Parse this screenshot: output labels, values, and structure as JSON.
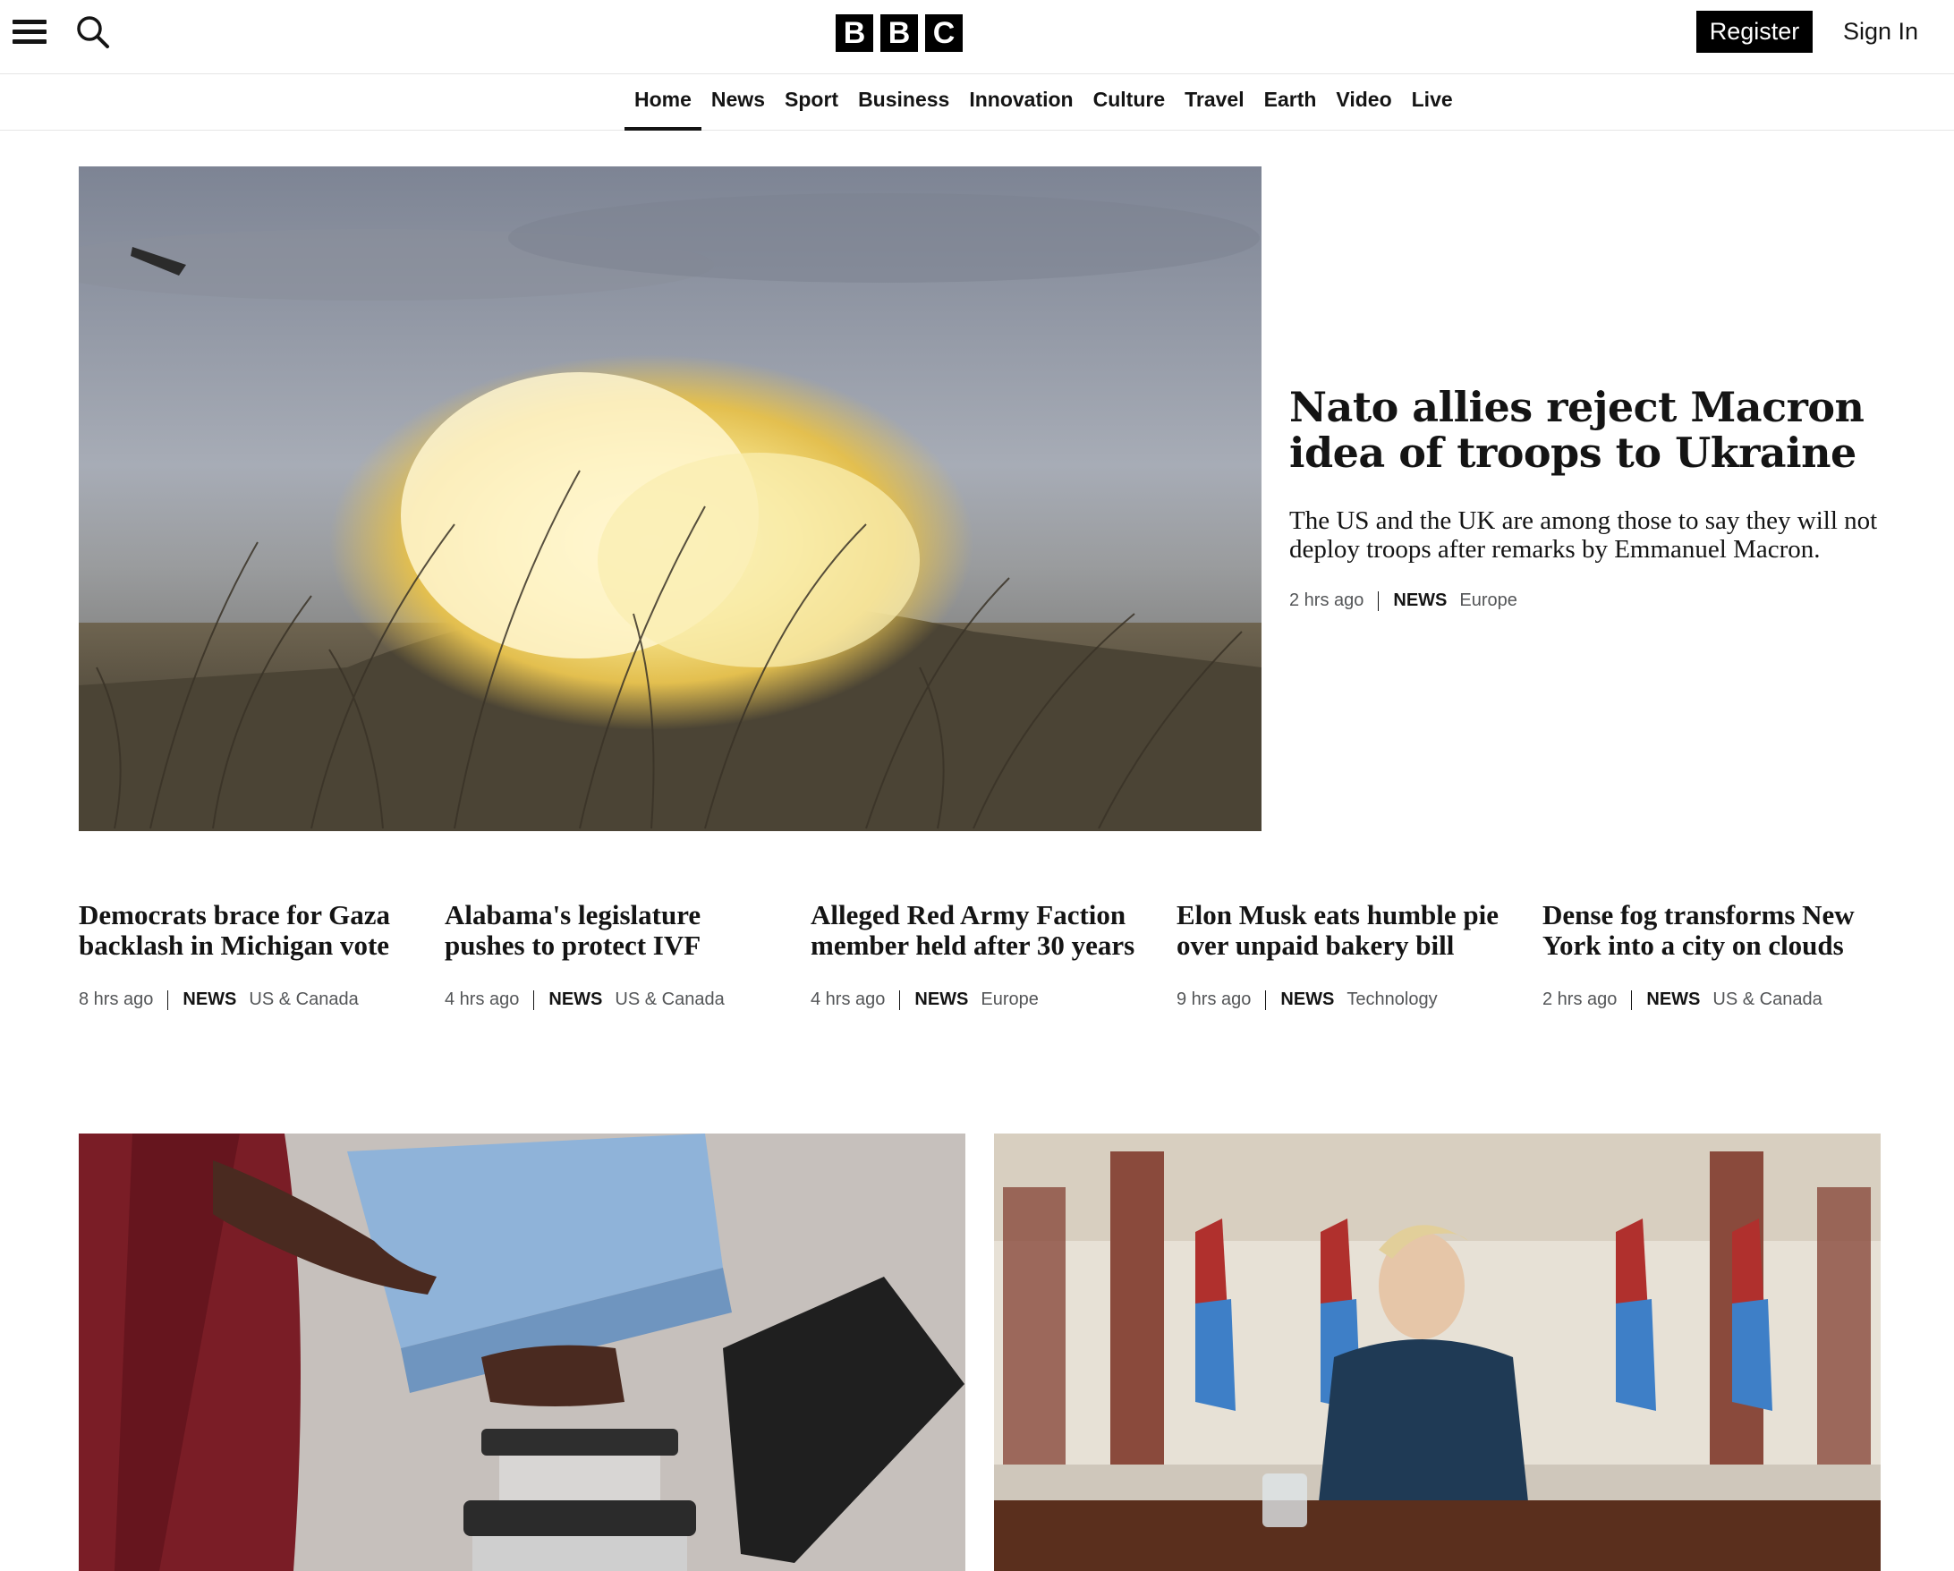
{
  "header": {
    "logo_letters": [
      "B",
      "B",
      "C"
    ],
    "register_label": "Register",
    "signin_label": "Sign In"
  },
  "nav": {
    "items": [
      {
        "label": "Home",
        "active": true
      },
      {
        "label": "News"
      },
      {
        "label": "Sport"
      },
      {
        "label": "Business"
      },
      {
        "label": "Innovation"
      },
      {
        "label": "Culture"
      },
      {
        "label": "Travel"
      },
      {
        "label": "Earth"
      },
      {
        "label": "Video"
      },
      {
        "label": "Live"
      }
    ]
  },
  "hero": {
    "title": "Nato allies reject Macron idea of troops to Ukraine",
    "summary": "The US and the UK are among those to say they will not deploy troops after remarks by Emmanuel Macron.",
    "time": "2 hrs ago",
    "section": "NEWS",
    "region": "Europe"
  },
  "stories": [
    {
      "title": "Democrats brace for Gaza backlash in Michigan vote",
      "time": "8 hrs ago",
      "section": "NEWS",
      "region": "US & Canada"
    },
    {
      "title": "Alabama's legislature pushes to protect IVF",
      "time": "4 hrs ago",
      "section": "NEWS",
      "region": "US & Canada"
    },
    {
      "title": "Alleged Red Army Faction member held after 30 years",
      "time": "4 hrs ago",
      "section": "NEWS",
      "region": "Europe"
    },
    {
      "title": "Elon Musk eats humble pie over unpaid bakery bill",
      "time": "9 hrs ago",
      "section": "NEWS",
      "region": "Technology"
    },
    {
      "title": "Dense fog transforms New York into a city on clouds",
      "time": "2 hrs ago",
      "section": "NEWS",
      "region": "US & Canada"
    }
  ],
  "icons": {
    "menu": "hamburger-menu-icon",
    "search": "search-icon"
  },
  "colors": {
    "brand": "#000000",
    "text": "#141414",
    "meta": "#545658"
  }
}
